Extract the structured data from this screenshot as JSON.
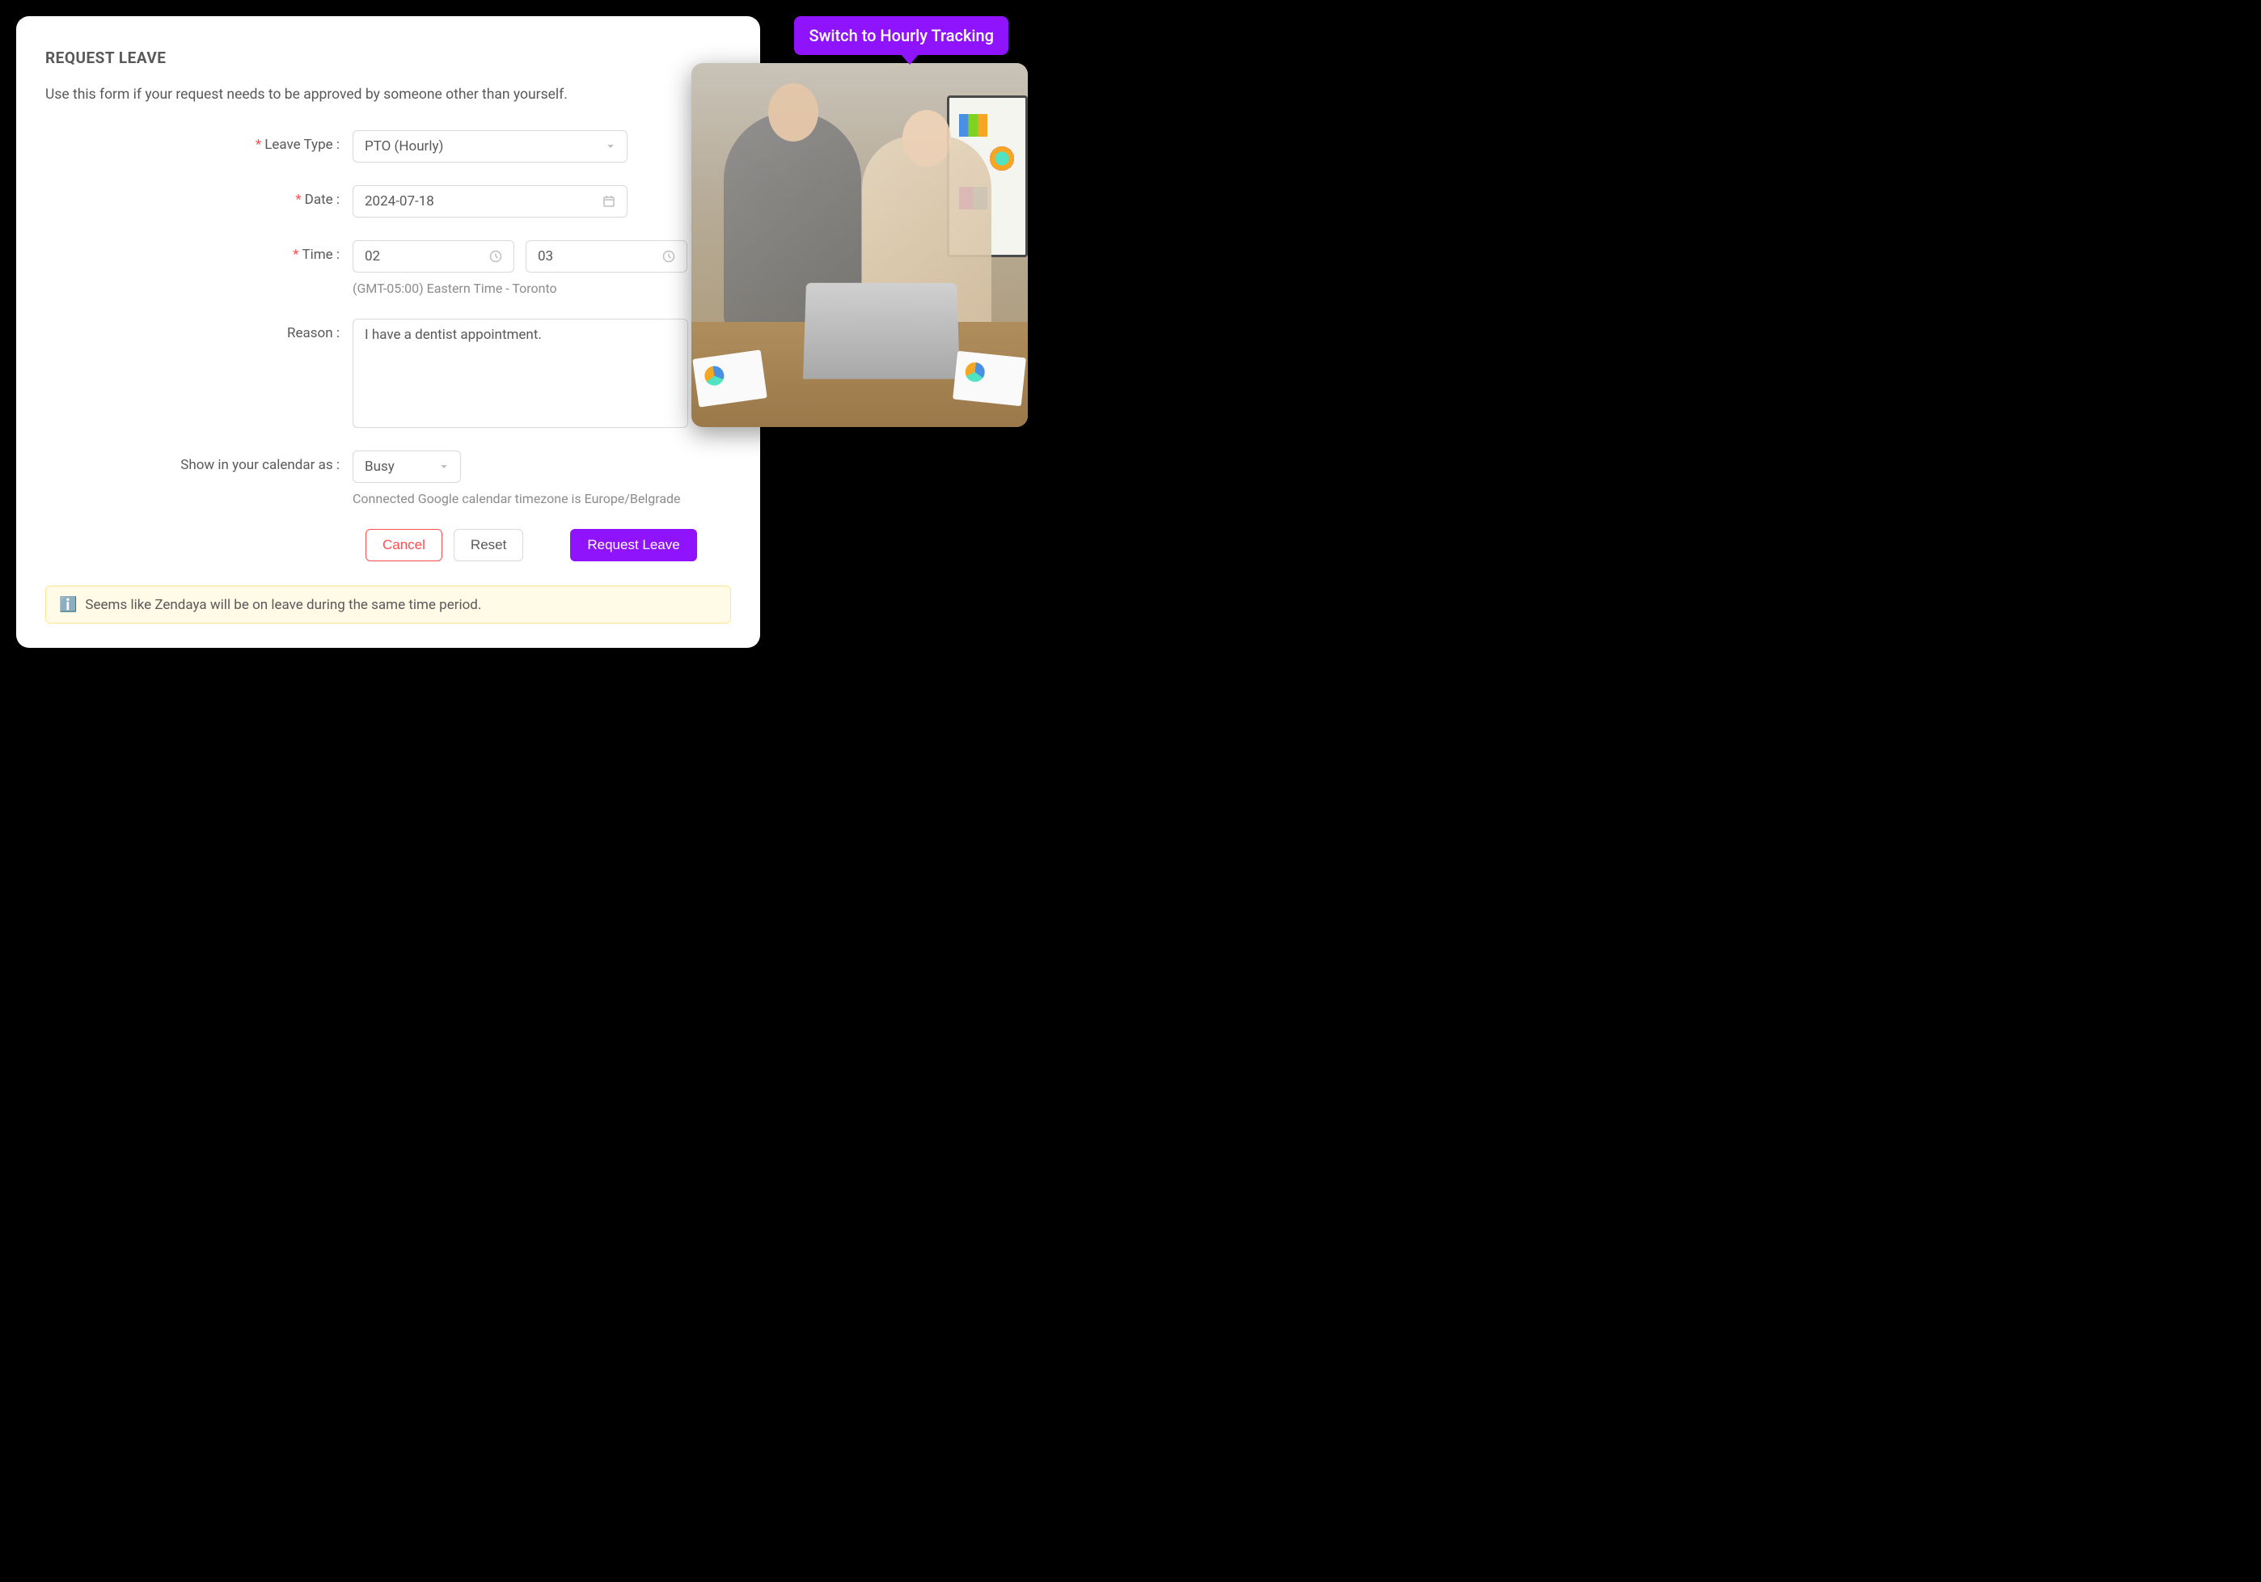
{
  "modal": {
    "title": "REQUEST LEAVE",
    "subtitle": "Use this form if your request needs to be approved by someone other than yourself."
  },
  "form": {
    "leaveType": {
      "label": "Leave Type",
      "value": "PTO (Hourly)"
    },
    "date": {
      "label": "Date",
      "value": "2024-07-18"
    },
    "time": {
      "label": "Time",
      "start": "02",
      "end": "03",
      "helper": "(GMT-05:00) Eastern Time - Toronto"
    },
    "reason": {
      "label": "Reason",
      "value": "I have a dentist appointment."
    },
    "calendarStatus": {
      "label": "Show in your calendar as",
      "value": "Busy",
      "helper": "Connected Google calendar timezone is Europe/Belgrade"
    }
  },
  "buttons": {
    "cancel": "Cancel",
    "reset": "Reset",
    "submit": "Request Leave"
  },
  "alert": {
    "text": "Seems like Zendaya will be on leave during the same time period."
  },
  "tooltip": {
    "text": "Switch to Hourly Tracking"
  }
}
